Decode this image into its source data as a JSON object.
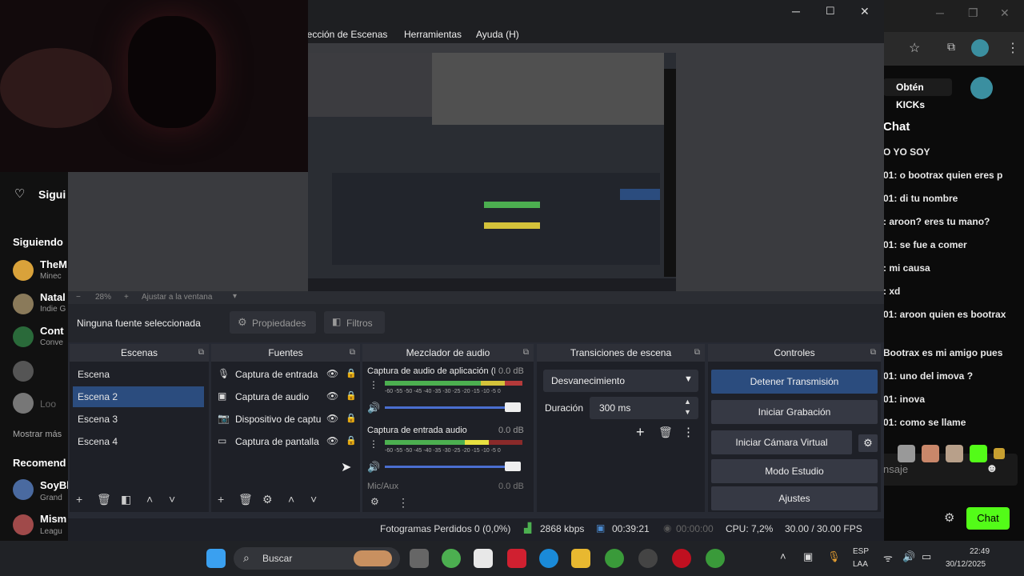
{
  "obs": {
    "menu": [
      "lección de Escenas",
      "Herramientas",
      "Ayuda (H)"
    ],
    "zoom_label": "28%",
    "zoom_mode": "Ajustar a la ventana",
    "no_source": "Ninguna fuente seleccionada",
    "properties_label": "Propiedades",
    "filters_label": "Filtros",
    "docks": {
      "scenes": "Escenas",
      "sources": "Fuentes",
      "mixer": "Mezclador de audio",
      "transitions": "Transiciones de escena",
      "controls": "Controles"
    },
    "scenes": [
      "Escena",
      "Escena 2",
      "Escena 3",
      "Escena 4"
    ],
    "selected_scene": "Escena 2",
    "sources": [
      "Captura de entrada",
      "Captura de audio",
      "Dispositivo de captura",
      "Captura de pantalla"
    ],
    "mixer": [
      {
        "name": "Captura de audio de aplicación (B",
        "db": "0.0 dB"
      },
      {
        "name": "Captura de entrada audio",
        "db": "0.0 dB"
      },
      {
        "name": "Mic/Aux",
        "db": "0.0 dB"
      }
    ],
    "meter_ticks": "-60 -55 -50 -45 -40 -35 -30 -25 -20 -15 -10 -5 0",
    "transition": {
      "type": "Desvanecimiento",
      "duration_label": "Duración",
      "duration_value": "300 ms"
    },
    "controls": [
      "Detener Transmisión",
      "Iniciar Grabación",
      "Iniciar Cámara Virtual",
      "Modo Estudio",
      "Ajustes"
    ],
    "status": {
      "dropped": "Fotogramas Perdidos 0 (0,0%)",
      "bitrate": "2868 kbps",
      "stream_time": "00:39:21",
      "rec_time": "00:00:00",
      "cpu": "CPU: 7,2%",
      "fps": "30.00 / 30.00 FPS"
    }
  },
  "kick": {
    "follow_label": "Sigui",
    "following_label": "Siguiendo",
    "show_more": "Mostrar más",
    "recommended": "Recomend",
    "channels": [
      "TheM",
      "Natal",
      "Cont",
      "",
      "Loo"
    ],
    "channel_sub": [
      "Minec",
      "Indie G",
      "Conve"
    ],
    "rec_channels": [
      "SoyBl",
      "Mism"
    ],
    "rec_sub": [
      "Grand",
      "Leagu"
    ],
    "kicks_label": "Obtén KICKs",
    "chat_title": "Chat",
    "chat_lines": [
      "O YO SOY",
      "01: o bootrax quien eres p",
      "01: di tu nombre",
      ": aroon? eres tu mano?",
      "01: se fue a comer",
      ": mi causa",
      ": xd",
      "01: aroon quien es bootrax",
      "Bootrax es mi amigo pues",
      "01: uno del imova ?",
      "01: inova",
      "01: como se llame"
    ],
    "message_placeholder": "nsaje",
    "chat_button": "Chat"
  },
  "taskbar": {
    "search_label": "Buscar",
    "lang_top": "ESP",
    "lang_bottom": "LAA",
    "time": "22:49",
    "date": "30/12/2025"
  },
  "colors": {
    "accent": "#2b4c7e",
    "kick_green": "#53fc18",
    "obs_bg": "#272a33"
  }
}
